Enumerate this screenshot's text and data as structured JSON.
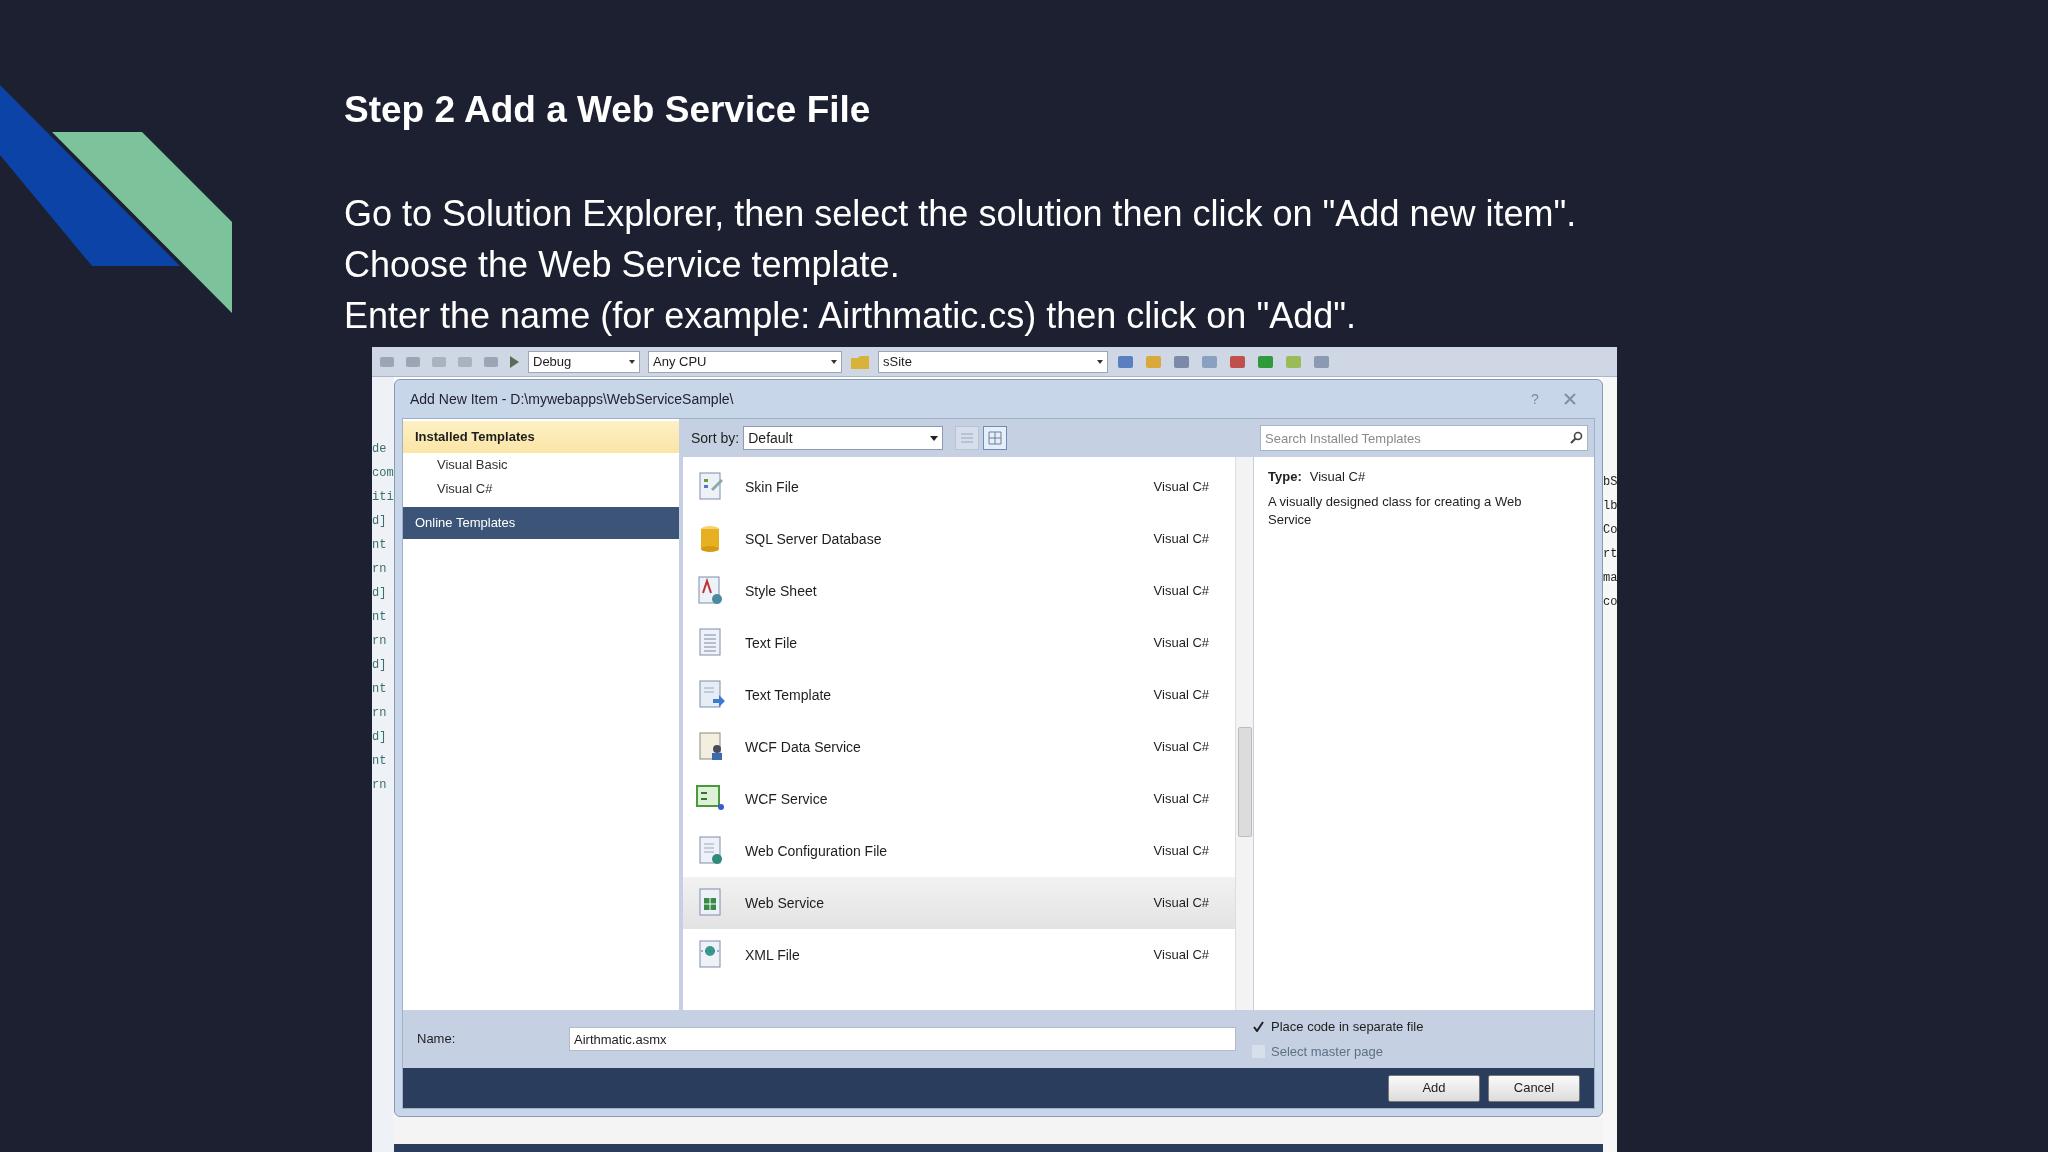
{
  "slide": {
    "title": "Step 2 Add a Web Service File",
    "lines": [
      "Go to Solution Explorer, then select the solution then click on \"Add new item\".",
      "Choose the Web Service template.",
      "Enter the name (for example: Airthmatic.cs) then click on \"Add\"."
    ]
  },
  "toolbar": {
    "dropdowns": [
      {
        "value": "Debug"
      },
      {
        "value": "Any CPU"
      },
      {
        "value": "sSite"
      }
    ]
  },
  "editor_fragments_left": [
    "de",
    "com",
    "iti",
    "d]",
    "nt",
    "rn",
    "d]",
    "nt",
    "rn",
    "d]",
    "nt",
    "rn",
    "d]",
    "nt",
    "rn"
  ],
  "editor_fragments_right": [
    "bS",
    "lb",
    "Co",
    "rt",
    "ma",
    "co"
  ],
  "dialog": {
    "title": "Add New Item - D:\\mywebapps\\WebServiceSample\\",
    "help_button": "?",
    "sidebar": [
      {
        "label": "Installed Templates",
        "kind": "heading",
        "selected": false,
        "children": [
          {
            "label": "Visual Basic",
            "selected": false
          },
          {
            "label": "Visual C#",
            "selected": false
          }
        ]
      },
      {
        "label": "Online Templates",
        "kind": "link",
        "selected": true
      }
    ],
    "sort_label": "Sort by:",
    "sort_value": "Default",
    "view_buttons": [
      {
        "selected": false
      },
      {
        "selected": true
      }
    ],
    "templates": [
      {
        "name": "Skin File",
        "language": "Visual C#",
        "selected": false
      },
      {
        "name": "SQL Server Database",
        "language": "Visual C#",
        "selected": false
      },
      {
        "name": "Style Sheet",
        "language": "Visual C#",
        "selected": false
      },
      {
        "name": "Text File",
        "language": "Visual C#",
        "selected": false
      },
      {
        "name": "Text Template",
        "language": "Visual C#",
        "selected": false
      },
      {
        "name": "WCF Data Service",
        "language": "Visual C#",
        "selected": false
      },
      {
        "name": "WCF Service",
        "language": "Visual C#",
        "selected": false
      },
      {
        "name": "Web Configuration File",
        "language": "Visual C#",
        "selected": false
      },
      {
        "name": "Web Service",
        "language": "Visual C#",
        "selected": true
      },
      {
        "name": "XML File",
        "language": "Visual C#",
        "selected": false
      }
    ],
    "search": {
      "placeholder": "Search Installed Templates"
    },
    "details": {
      "type_label": "Type:",
      "type_value": "Visual C#",
      "description": "A visually designed class for creating a Web Service"
    },
    "name_label": "Name:",
    "name_value": "Airthmatic.asmx",
    "options": [
      {
        "label": "Place code in separate file",
        "checked": true,
        "disabled": false
      },
      {
        "label": "Select master page",
        "checked": false,
        "disabled": true
      }
    ],
    "buttons": [
      "Add",
      "Cancel"
    ]
  }
}
